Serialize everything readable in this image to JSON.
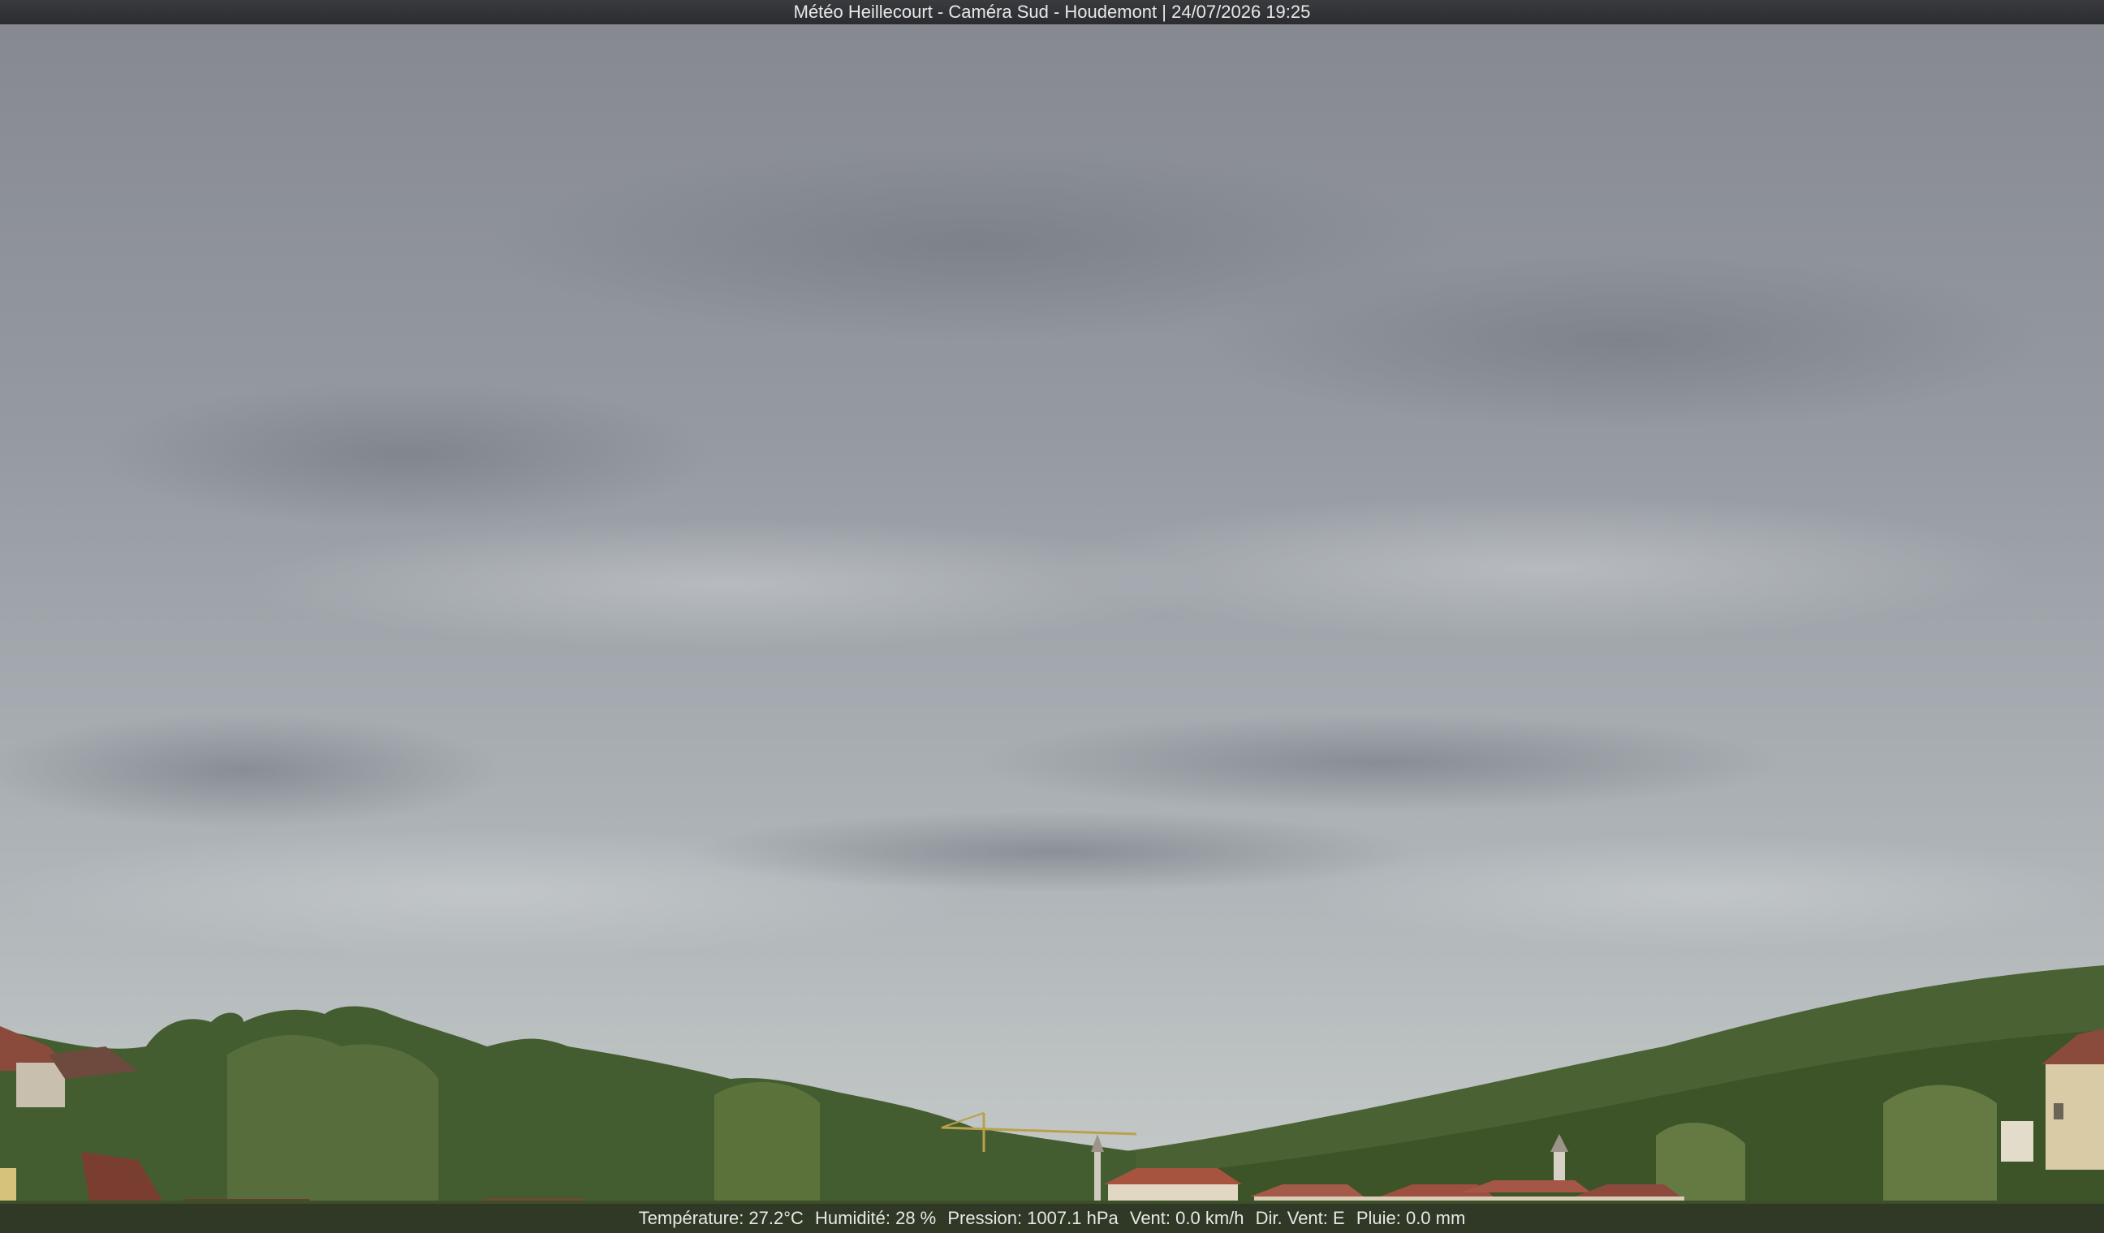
{
  "title": "Météo Heillecourt - Caméra Sud - Houdemont | 24/07/2026 19:25",
  "weather": {
    "temperature": "Température: 27.2°C",
    "humidity": "Humidité: 28 %",
    "pressure": "Pression: 1007.1 hPa",
    "wind": "Vent: 0.0 km/h",
    "wind_dir": "Dir. Vent: E",
    "rain": "Pluie: 0.0 mm"
  },
  "colors": {
    "sky_top": "#8c8f96",
    "sky_bottom": "#c4cacc",
    "trees": "#3f5a2c",
    "roofs": "#9b4a3a"
  }
}
